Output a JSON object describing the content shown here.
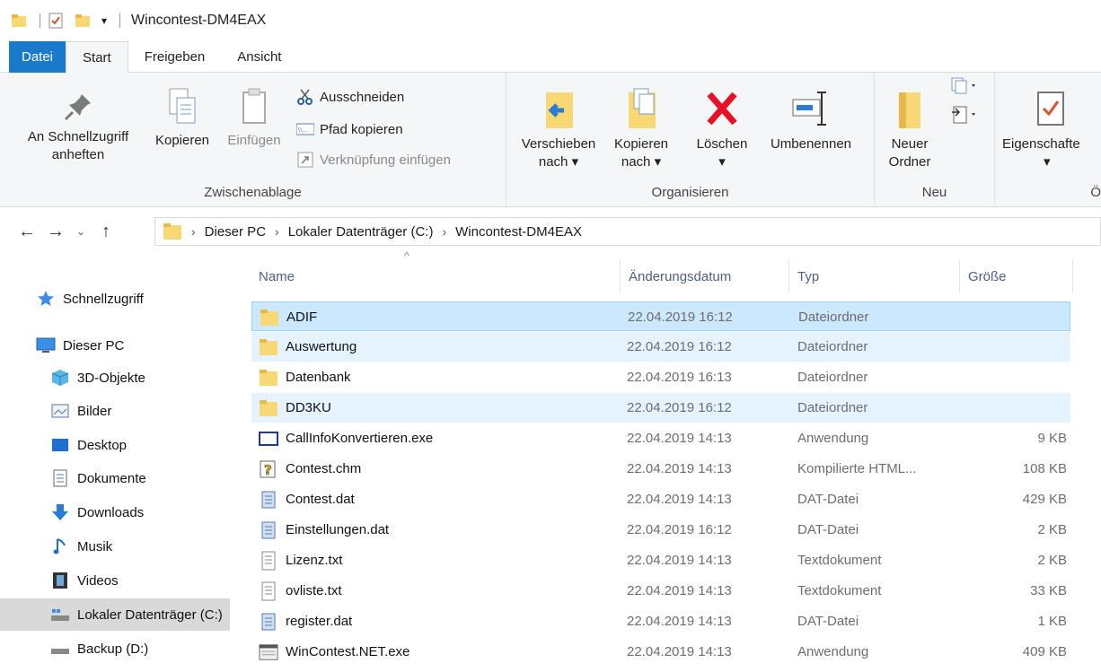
{
  "window": {
    "title": "Wincontest-DM4EAX"
  },
  "tabs": [
    {
      "label": "Datei"
    },
    {
      "label": "Start"
    },
    {
      "label": "Freigeben"
    },
    {
      "label": "Ansicht"
    }
  ],
  "ribbon": {
    "clipboard": {
      "pin_line1": "An Schnellzugriff",
      "pin_line2": "anheften",
      "copy": "Kopieren",
      "paste": "Einfügen",
      "cut": "Ausschneiden",
      "copy_path": "Pfad kopieren",
      "paste_shortcut": "Verknüpfung einfügen",
      "group": "Zwischenablage"
    },
    "organize": {
      "move_line1": "Verschieben",
      "move_line2": "nach",
      "copyto_line1": "Kopieren",
      "copyto_line2": "nach",
      "delete": "Löschen",
      "rename": "Umbenennen",
      "group": "Organisieren"
    },
    "new": {
      "folder_line1": "Neuer",
      "folder_line2": "Ordner",
      "group": "Neu"
    },
    "open": {
      "properties": "Eigenschafte",
      "group": "Ö"
    }
  },
  "address": {
    "crumbs": [
      "Dieser PC",
      "Lokaler Datenträger (C:)",
      "Wincontest-DM4EAX"
    ]
  },
  "sidebar": {
    "items": [
      {
        "label": "Schnellzugriff",
        "icon": "star-icon"
      },
      {
        "label": "Dieser PC",
        "icon": "computer-icon"
      },
      {
        "label": "3D-Objekte",
        "icon": "cube-icon"
      },
      {
        "label": "Bilder",
        "icon": "pictures-icon"
      },
      {
        "label": "Desktop",
        "icon": "desktop-icon"
      },
      {
        "label": "Dokumente",
        "icon": "document-icon"
      },
      {
        "label": "Downloads",
        "icon": "download-icon"
      },
      {
        "label": "Musik",
        "icon": "music-icon"
      },
      {
        "label": "Videos",
        "icon": "video-icon"
      },
      {
        "label": "Lokaler Datenträger (C:)",
        "icon": "drive-icon"
      },
      {
        "label": "Backup (D:)",
        "icon": "drive-icon"
      }
    ]
  },
  "columns": {
    "name": "Name",
    "date": "Änderungsdatum",
    "type": "Typ",
    "size": "Größe"
  },
  "files": [
    {
      "name": "ADIF",
      "date": "22.04.2019 16:12",
      "type": "Dateiordner",
      "size": "",
      "icon": "folder-icon"
    },
    {
      "name": "Auswertung",
      "date": "22.04.2019 16:12",
      "type": "Dateiordner",
      "size": "",
      "icon": "folder-icon"
    },
    {
      "name": "Datenbank",
      "date": "22.04.2019 16:13",
      "type": "Dateiordner",
      "size": "",
      "icon": "folder-icon"
    },
    {
      "name": "DD3KU",
      "date": "22.04.2019 16:12",
      "type": "Dateiordner",
      "size": "",
      "icon": "folder-icon"
    },
    {
      "name": "CallInfoKonvertieren.exe",
      "date": "22.04.2019 14:13",
      "type": "Anwendung",
      "size": "9 KB",
      "icon": "app-icon"
    },
    {
      "name": "Contest.chm",
      "date": "22.04.2019 14:13",
      "type": "Kompilierte HTML...",
      "size": "108 KB",
      "icon": "help-file-icon"
    },
    {
      "name": "Contest.dat",
      "date": "22.04.2019 14:13",
      "type": "DAT-Datei",
      "size": "429 KB",
      "icon": "dat-file-icon"
    },
    {
      "name": "Einstellungen.dat",
      "date": "22.04.2019 16:12",
      "type": "DAT-Datei",
      "size": "2 KB",
      "icon": "dat-file-icon"
    },
    {
      "name": "Lizenz.txt",
      "date": "22.04.2019 14:13",
      "type": "Textdokument",
      "size": "2 KB",
      "icon": "text-file-icon"
    },
    {
      "name": "ovliste.txt",
      "date": "22.04.2019 14:13",
      "type": "Textdokument",
      "size": "33 KB",
      "icon": "text-file-icon"
    },
    {
      "name": "register.dat",
      "date": "22.04.2019 14:13",
      "type": "DAT-Datei",
      "size": "1 KB",
      "icon": "dat-file-icon"
    },
    {
      "name": "WinContest.NET.exe",
      "date": "22.04.2019 14:13",
      "type": "Anwendung",
      "size": "409 KB",
      "icon": "app-window-icon"
    }
  ]
}
